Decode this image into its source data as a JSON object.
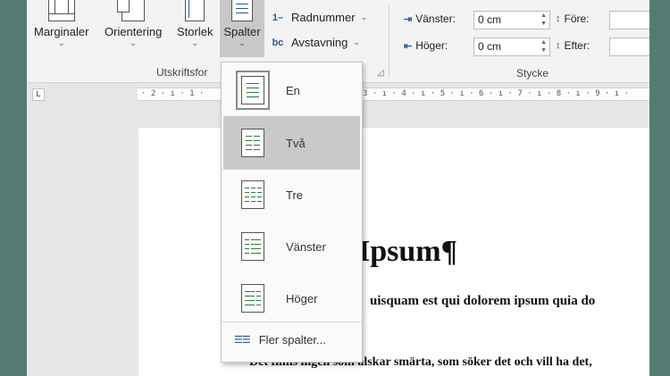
{
  "ribbon": {
    "buttons": [
      {
        "label": "Marginaler",
        "chevron": "⌄",
        "icon": "margins-icon"
      },
      {
        "label": "Orientering",
        "chevron": "⌄",
        "icon": "orientation-icon"
      },
      {
        "label": "Storlek",
        "chevron": "⌄",
        "icon": "size-icon"
      },
      {
        "label": "Spalter",
        "chevron": "⌄",
        "icon": "columns-icon"
      }
    ],
    "small_items": [
      {
        "label": "Radnummer",
        "chevron": "⌄",
        "icon_text": "1–"
      },
      {
        "label": "Avstavning",
        "chevron": "⌄",
        "icon_text": "bc"
      }
    ],
    "group_label_page_setup": "Utskriftsfor",
    "group_label_paragraph": "Stycke",
    "indent": {
      "left_label": "Vänster:",
      "left_value": "0 cm",
      "right_label": "Höger:",
      "right_value": "0 cm"
    },
    "spacing": {
      "before_label": "Före:",
      "after_label": "Efter:"
    }
  },
  "ruler": {
    "tab_selector": "L",
    "left_text": "· 2 · ı · 1 ·",
    "right_text": "3 · ı · 4 · ı · 5 · ı · 6 · ı · 7 · ı · 8 · ı · 9 · ı ·"
  },
  "document": {
    "heading": "Ipsum¶",
    "line1": "uisquam est qui dolorem ipsum quia do",
    "line2": "Det finns ingen som älskar smärta, som söker det och vill ha det,"
  },
  "columns_menu": {
    "items": [
      {
        "label": "En",
        "columns": 1
      },
      {
        "label": "Två",
        "columns": 2
      },
      {
        "label": "Tre",
        "columns": 3
      },
      {
        "label": "Vänster",
        "columns": 2
      },
      {
        "label": "Höger",
        "columns": 2
      }
    ],
    "more_label": "Fler spalter...",
    "selected_index": 0,
    "hover_index": 1
  },
  "colors": {
    "accent": "#2b579a",
    "background": "#557b72",
    "menu_hover": "#c9c9c9",
    "column_line": "#2b7a3b"
  }
}
